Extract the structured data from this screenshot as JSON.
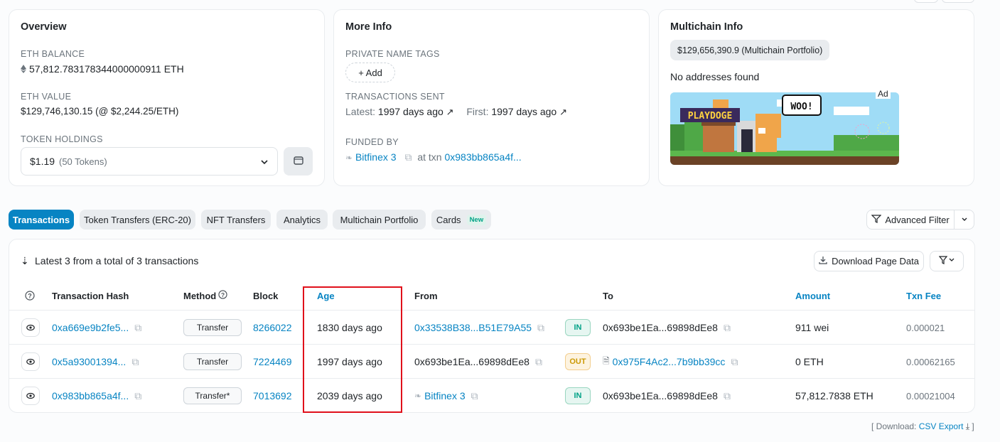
{
  "overview": {
    "title": "Overview",
    "eth_balance_label": "ETH BALANCE",
    "eth_balance_value": "57,812.783178344000000911 ETH",
    "eth_value_label": "ETH VALUE",
    "eth_value_value": "$129,746,130.15 (@ $2,244.25/ETH)",
    "token_holdings_label": "TOKEN HOLDINGS",
    "token_holdings_value": "$1.19",
    "token_holdings_count": "(50 Tokens)"
  },
  "more_info": {
    "title": "More Info",
    "private_tags_label": "PRIVATE NAME TAGS",
    "add_label": "+ Add",
    "tx_sent_label": "TRANSACTIONS SENT",
    "latest_label": "Latest:",
    "latest_value": "1997 days ago",
    "first_label": "First:",
    "first_value": "1997 days ago",
    "funded_by_label": "FUNDED BY",
    "funded_by_name": "Bitfinex 3",
    "at_txn_label": "at txn",
    "funded_txn": "0x983bb865a4f..."
  },
  "multichain": {
    "title": "Multichain Info",
    "portfolio_value": "$129,656,390.9",
    "portfolio_label": "(Multichain Portfolio)",
    "no_addresses": "No addresses found",
    "ad_label": "Ad",
    "ad_text": "PLAYDOGE",
    "ad_bubble": "WOO!"
  },
  "tabs": [
    {
      "label": "Transactions",
      "active": true
    },
    {
      "label": "Token Transfers (ERC-20)"
    },
    {
      "label": "NFT Transfers"
    },
    {
      "label": "Analytics"
    },
    {
      "label": "Multichain Portfolio"
    },
    {
      "label": "Cards"
    }
  ],
  "cards_badge": "New",
  "advanced_filter_label": "Advanced Filter",
  "table": {
    "summary": "Latest 3 from a total of 3 transactions",
    "download_label": "Download Page Data",
    "headers": {
      "hash": "Transaction Hash",
      "method": "Method",
      "block": "Block",
      "age": "Age",
      "from": "From",
      "to": "To",
      "amount": "Amount",
      "fee": "Txn Fee"
    },
    "rows": [
      {
        "hash": "0xa669e9b2fe5...",
        "method": "Transfer",
        "block": "8266022",
        "age": "1830 days ago",
        "from": "0x33538B38...B51E79A55",
        "dir": "IN",
        "to": "0x693be1Ea...69898dEe8",
        "amount": "911 wei",
        "fee": "0.000021"
      },
      {
        "hash": "0x5a93001394...",
        "method": "Transfer",
        "block": "7224469",
        "age": "1997 days ago",
        "from": "0x693be1Ea...69898dEe8",
        "dir": "OUT",
        "to": "0x975F4Ac2...7b9bb39cc",
        "amount": "0 ETH",
        "fee": "0.00062165"
      },
      {
        "hash": "0x983bb865a4f...",
        "method": "Transfer*",
        "block": "7013692",
        "age": "2039 days ago",
        "from": "Bitfinex 3",
        "dir": "IN",
        "to": "0x693be1Ea...69898dEe8",
        "amount": "57,812.7838 ETH",
        "fee": "0.00021004"
      }
    ]
  },
  "footer": {
    "download_label": "[ Download:",
    "csv_label": "CSV Export",
    "close_bracket": "]"
  },
  "colors": {
    "accent": "#0784c3",
    "highlight_box": "#e0101b",
    "in_badge": "#00a186",
    "out_badge": "#cc9a06"
  }
}
